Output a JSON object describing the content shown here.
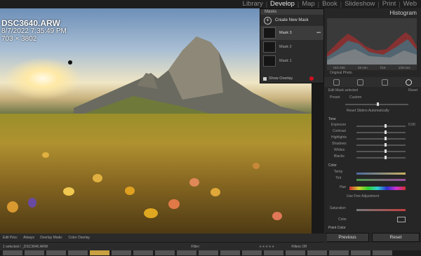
{
  "modules": [
    "Library",
    "Develop",
    "Map",
    "Book",
    "Slideshow",
    "Print",
    "Web"
  ],
  "active_module": "Develop",
  "photo": {
    "filename": "DSC3640.ARW",
    "date": "8/7/2022 7:35:49 PM",
    "dimensions": "703 × 3802"
  },
  "masks_panel": {
    "title": "Masks",
    "create_label": "Create New Mask",
    "masks": [
      "Mask 3",
      "Mask 2",
      "Mask 1"
    ],
    "show_overlay_label": "Show Overlay"
  },
  "right_panel": {
    "histogram_label": "Histogram",
    "original_photo_label": "Original Photo",
    "histogram_footer": [
      "ISO 200",
      "28 mm",
      "f/16",
      "1/20 sec"
    ],
    "edit_label": "Edit Mask selected",
    "reset_label": "Reset",
    "preset_label": "Preset",
    "preset_value": "Custom",
    "reset_sliders_label": "Reset Sliders Automatically",
    "tone_label": "Tone",
    "tone_rows": [
      "Exposure",
      "Contrast",
      "Highlights",
      "Shadows",
      "Whites",
      "Blacks"
    ],
    "exposure_value": "0.00",
    "color_label": "Color",
    "color_rows": [
      "Temp",
      "Tint",
      "Hue",
      "Saturation",
      "Color"
    ],
    "fine_adj_label": "Use Fine Adjustment",
    "point_color_label": "Point Color",
    "previous_button": "Previous",
    "reset_button": "Reset"
  },
  "toolbar": {
    "edit_pins_label": "Edit Pins:",
    "edit_pins_value": "Always",
    "overlay_mode_label": "Overlay Mode:",
    "overlay_mode_value": "Color Overlay"
  },
  "filmstrip": {
    "status": "1 selected / _DSC3640.ARW",
    "filter_label": "Filter:",
    "filters_off": "Filters Off"
  }
}
